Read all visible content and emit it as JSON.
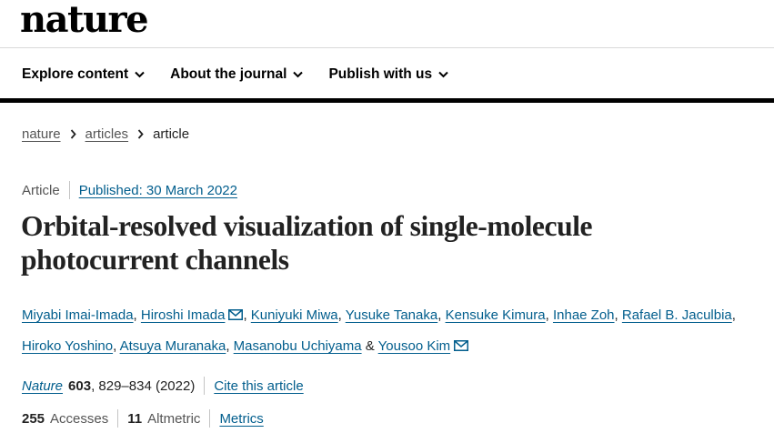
{
  "header": {
    "logo": "nature"
  },
  "nav": {
    "items": [
      {
        "label": "Explore content"
      },
      {
        "label": "About the journal"
      },
      {
        "label": "Publish with us"
      }
    ]
  },
  "breadcrumb": {
    "items": [
      "nature",
      "articles",
      "article"
    ]
  },
  "article": {
    "type": "Article",
    "published": "Published: 30 March 2022",
    "title": "Orbital-resolved visualization of single-molecule photocurrent channels",
    "authors": [
      "Miyabi Imai-Imada",
      "Hiroshi Imada",
      "Kuniyuki Miwa",
      "Yusuke Tanaka",
      "Kensuke Kimura",
      "Inhae Zoh",
      "Rafael B. Jaculbia",
      "Hiroko Yoshino",
      "Atsuya Muranaka",
      "Masanobu Uchiyama",
      "Yousoo Kim"
    ],
    "author_sep": ",",
    "author_amp": "&",
    "journal": "Nature",
    "volume": "603",
    "pages_year": ", 829–834 (2022)",
    "cite_label": "Cite this article",
    "accesses_count": "255",
    "accesses_label": "Accesses",
    "altmetric_count": "11",
    "altmetric_label": "Altmetric",
    "metrics_label": "Metrics"
  },
  "icons": {
    "chevron": "chevron-down-icon",
    "breadcrumb_separator": "chevron-right-icon",
    "email": "envelope-icon"
  },
  "colors": {
    "link": "#025e8d",
    "text": "#222222",
    "rule": "#000000"
  }
}
